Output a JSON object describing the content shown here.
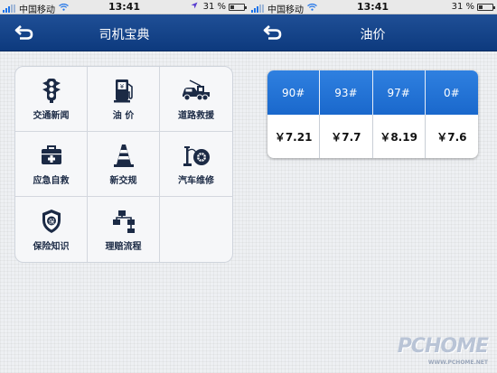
{
  "status_bar": {
    "carrier": "中国移动",
    "time": "13:41",
    "battery": "31 %",
    "battery_level": 0.31
  },
  "left_screen": {
    "title": "司机宝典",
    "menu": [
      {
        "label": "交通新闻",
        "icon": "traffic-light-icon"
      },
      {
        "label": "油 价",
        "icon": "gas-pump-icon"
      },
      {
        "label": "道路救援",
        "icon": "tow-truck-icon"
      },
      {
        "label": "应急自救",
        "icon": "first-aid-kit-icon"
      },
      {
        "label": "新交规",
        "icon": "traffic-cone-icon"
      },
      {
        "label": "汽车维修",
        "icon": "tire-pump-icon"
      },
      {
        "label": "保险知识",
        "icon": "insurance-shield-icon"
      },
      {
        "label": "理赔流程",
        "icon": "flowchart-icon"
      }
    ]
  },
  "right_screen": {
    "title": "油价",
    "fuel_grades": [
      "90#",
      "93#",
      "97#",
      "0#"
    ],
    "prices": [
      "￥7.21",
      "￥7.7",
      "￥8.19",
      "￥7.6"
    ]
  },
  "watermark": {
    "logo": "PCHOME",
    "url": "WWW.PCHOME.NET"
  },
  "colors": {
    "navbar": "#0d3a7e",
    "table_header": "#1a68cc",
    "signal": "#1e73e8"
  }
}
